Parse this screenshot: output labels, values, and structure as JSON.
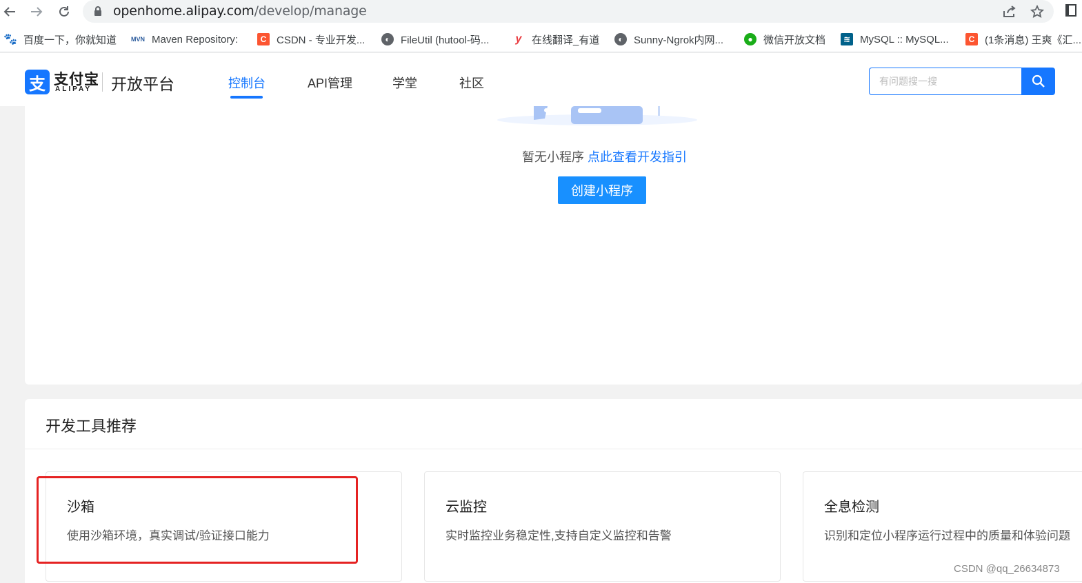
{
  "browser": {
    "url_host": "openhome.alipay.com",
    "url_path": "/develop/manage",
    "bookmarks": [
      {
        "label": "百度一下，你就知道",
        "icon": "baidu-paw-icon",
        "color": "#2932e1"
      },
      {
        "label": "Maven Repository:",
        "icon": "mvn-icon",
        "color": "#2b5b9c"
      },
      {
        "label": "CSDN - 专业开发...",
        "icon": "csdn-icon",
        "color": "#fc5531"
      },
      {
        "label": "FileUtil (hutool-码...",
        "icon": "globe-icon",
        "color": "#5f6368"
      },
      {
        "label": "在线翻译_有道",
        "icon": "youdao-icon",
        "color": "#e93c40"
      },
      {
        "label": "Sunny-Ngrok内网...",
        "icon": "globe-icon",
        "color": "#5f6368"
      },
      {
        "label": "微信开放文档",
        "icon": "wechat-icon",
        "color": "#1aad19"
      },
      {
        "label": "MySQL :: MySQL...",
        "icon": "mysql-icon",
        "color": "#00618a"
      },
      {
        "label": "(1条消息) 王爽《汇...",
        "icon": "csdn-icon",
        "color": "#fc5531"
      }
    ]
  },
  "header": {
    "logo_cn": "支付宝",
    "logo_en": "ALIPAY",
    "platform": "开放平台",
    "nav": [
      {
        "label": "控制台",
        "active": true
      },
      {
        "label": "API管理",
        "active": false
      },
      {
        "label": "学堂",
        "active": false
      },
      {
        "label": "社区",
        "active": false
      }
    ],
    "search_placeholder": "有问题搜一搜",
    "accent": "#1677ff"
  },
  "empty_state": {
    "text": "暂无小程序",
    "link": "点此查看开发指引",
    "button": "创建小程序"
  },
  "tools": {
    "title": "开发工具推荐",
    "cards": [
      {
        "title": "沙箱",
        "desc": "使用沙箱环境，真实调试/验证接口能力"
      },
      {
        "title": "云监控",
        "desc": "实时监控业务稳定性,支持自定义监控和告警"
      },
      {
        "title": "全息检测",
        "desc": "识别和定位小程序运行过程中的质量和体验问题"
      }
    ]
  },
  "watermark": "CSDN @qq_26634873"
}
